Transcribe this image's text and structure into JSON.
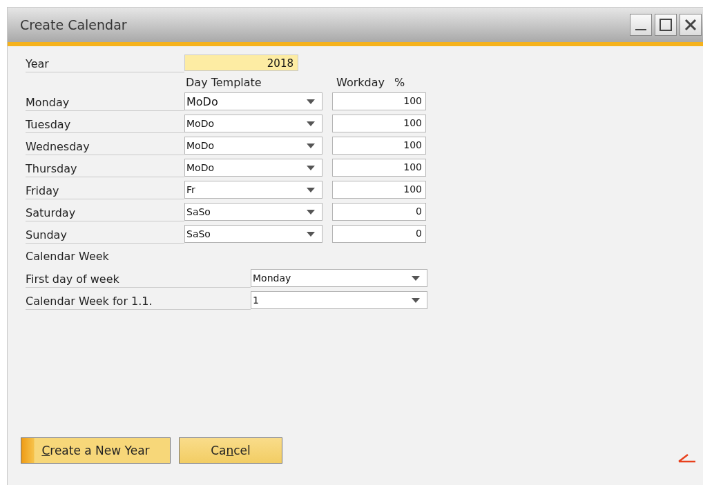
{
  "window": {
    "title": "Create Calendar"
  },
  "year": {
    "label": "Year",
    "value": "2018",
    "highlighted": true
  },
  "columns": {
    "template": "Day Template",
    "workday": "Workday",
    "percent": "%"
  },
  "days": [
    {
      "label": "Monday",
      "template": "MoDo",
      "workday": "100"
    },
    {
      "label": "Tuesday",
      "template": "MoDo",
      "workday": "100"
    },
    {
      "label": "Wednesday",
      "template": "MoDo",
      "workday": "100"
    },
    {
      "label": "Thursday",
      "template": "MoDo",
      "workday": "100"
    },
    {
      "label": "Friday",
      "template": "Fr",
      "workday": "100"
    },
    {
      "label": "Saturday",
      "template": "SaSo",
      "workday": "0"
    },
    {
      "label": "Sunday",
      "template": "SaSo",
      "workday": "0"
    }
  ],
  "calendar_week": {
    "heading": "Calendar Week",
    "fields": [
      {
        "label": "First day of week",
        "value": "Monday"
      },
      {
        "label": "Calendar Week for 1.1.",
        "value": "1"
      }
    ]
  },
  "buttons": [
    {
      "label_mnemonic": "C",
      "label_after": "reate a New Year",
      "focused": true
    },
    {
      "label_before": "Ca",
      "label_mnemonic": "n",
      "label_after": "cel",
      "focused": false
    }
  ]
}
